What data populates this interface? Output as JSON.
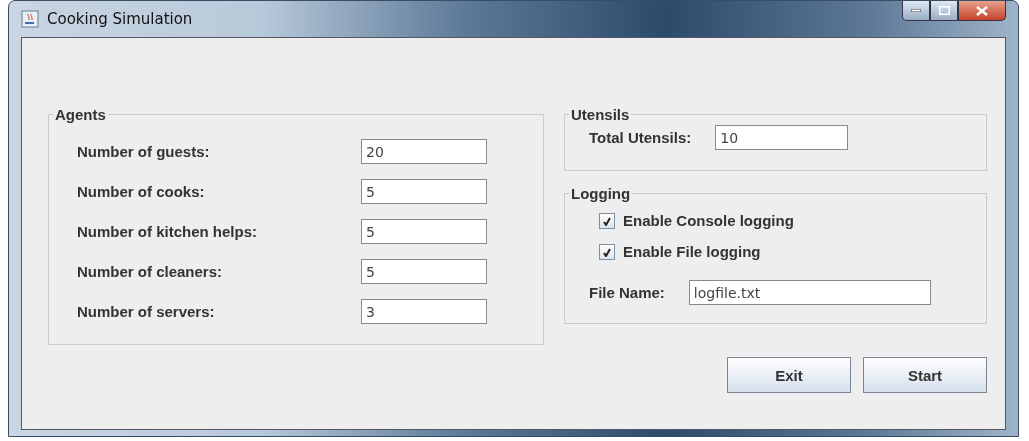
{
  "window": {
    "title": "Cooking Simulation"
  },
  "agents": {
    "title": "Agents",
    "fields": [
      {
        "label": "Number of guests:",
        "value": "20"
      },
      {
        "label": "Number of cooks:",
        "value": "5"
      },
      {
        "label": "Number of kitchen helps:",
        "value": "5"
      },
      {
        "label": "Number of cleaners:",
        "value": "5"
      },
      {
        "label": "Number of servers:",
        "value": "3"
      }
    ]
  },
  "utensils": {
    "title": "Utensils",
    "label": "Total Utensils:",
    "value": "10"
  },
  "logging": {
    "title": "Logging",
    "options": [
      {
        "label": "Enable Console logging",
        "checked": true
      },
      {
        "label": "Enable File logging",
        "checked": true
      }
    ],
    "file_label": "File Name:",
    "file_value": "logfile.txt"
  },
  "buttons": [
    "Exit",
    "Start"
  ]
}
